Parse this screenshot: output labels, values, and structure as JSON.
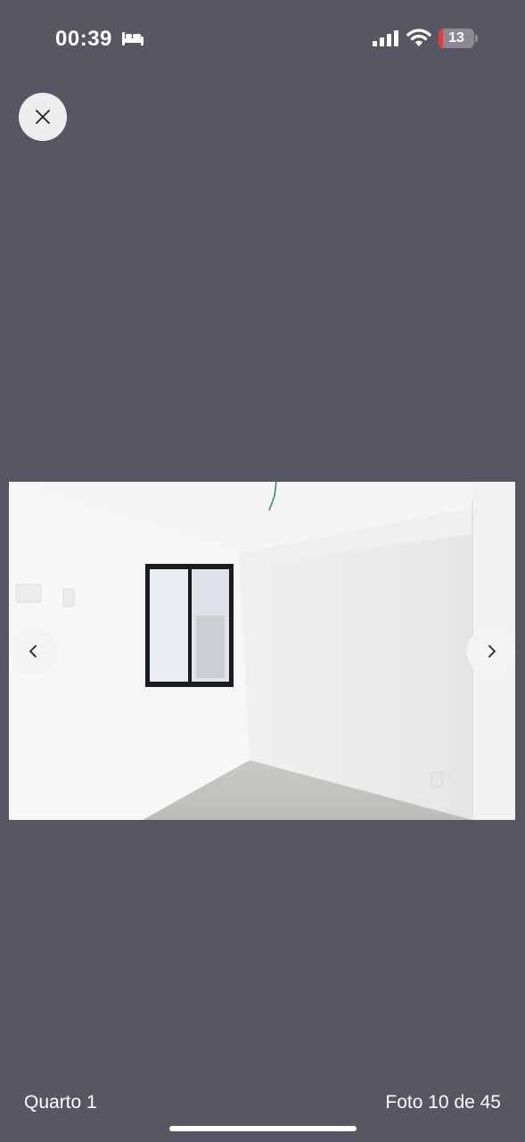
{
  "status_bar": {
    "time": "00:39",
    "battery_level": "13",
    "battery_percent": 13,
    "icons": [
      "bed-icon",
      "cellular-signal-icon",
      "wifi-icon",
      "battery-icon"
    ],
    "battery_low_color": "#e33b3b"
  },
  "viewer": {
    "close_icon": "close-icon",
    "prev_icon": "chevron-left-icon",
    "next_icon": "chevron-right-icon",
    "background_color": "#575764"
  },
  "photo": {
    "subject": "empty room with window"
  },
  "footer": {
    "caption": "Quarto 1",
    "counter": "Foto 10 de 45"
  }
}
